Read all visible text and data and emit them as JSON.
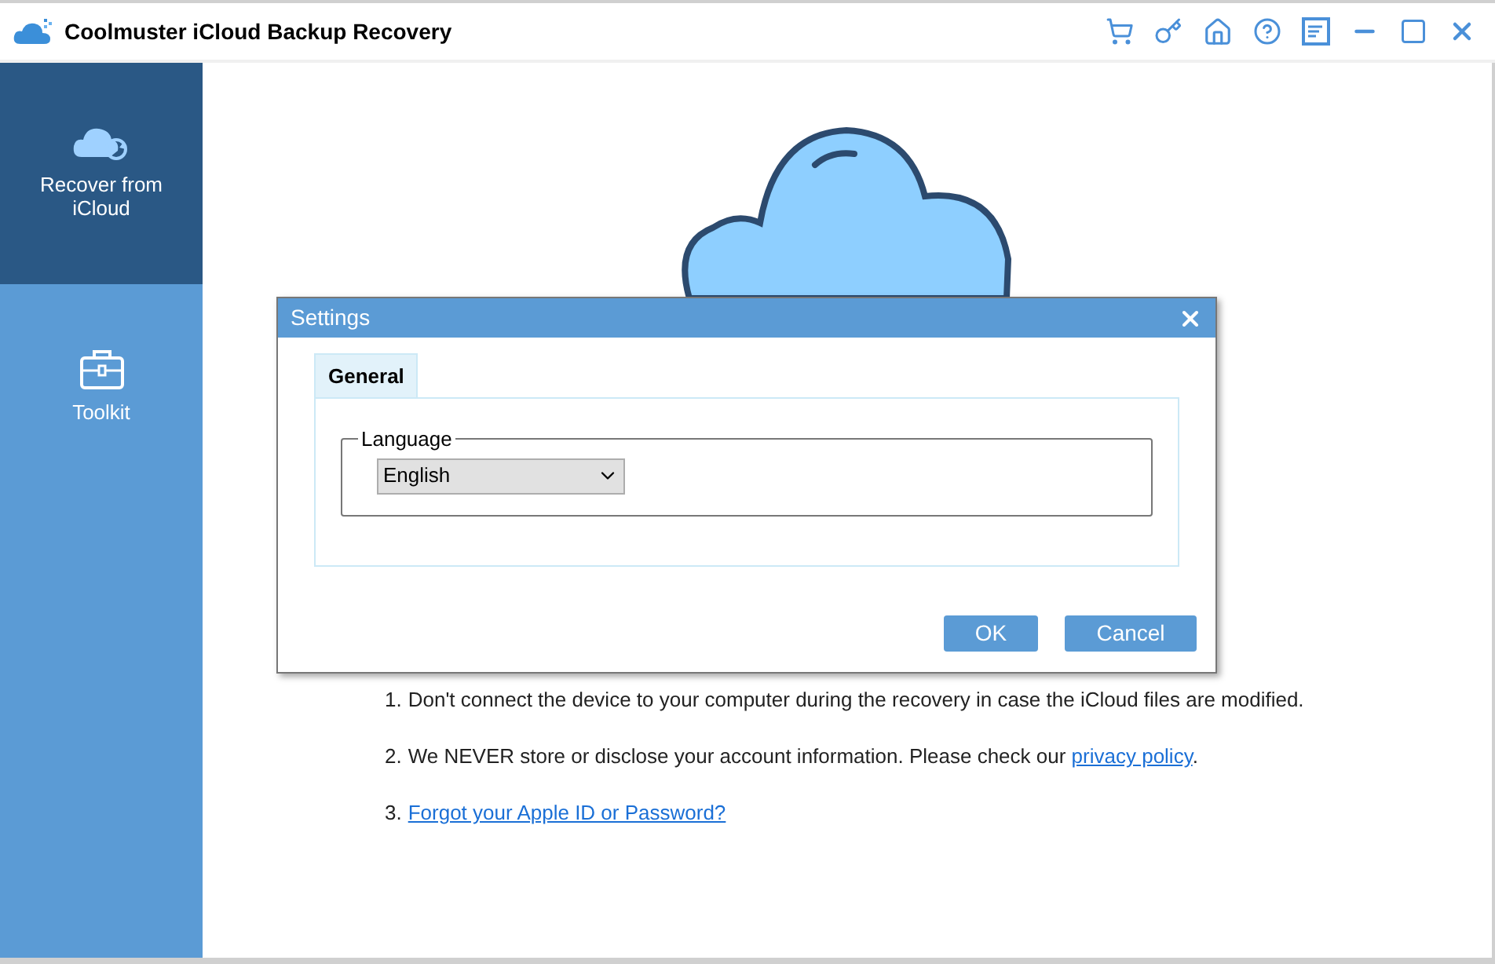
{
  "window": {
    "title": "Coolmuster iCloud Backup Recovery"
  },
  "sidebar": {
    "items": [
      {
        "label": "Recover from iCloud",
        "kind": "cloud",
        "selected": true
      },
      {
        "label": "Toolkit",
        "kind": "toolkit",
        "selected": false
      }
    ]
  },
  "notes": [
    {
      "number": "1.",
      "text": "Don't connect the device to your computer during the recovery in case the iCloud files are modified."
    },
    {
      "number": "2.",
      "text": "We NEVER store or disclose your account information. Please check our ",
      "link": "privacy policy",
      "after": "."
    },
    {
      "number": "3.",
      "link": "Forgot your Apple ID or Password?"
    }
  ],
  "dialog": {
    "title": "Settings",
    "tabs": [
      {
        "label": "General",
        "selected": true
      }
    ],
    "group_label": "Language",
    "language": "English",
    "buttons": [
      "OK",
      "Cancel"
    ]
  }
}
